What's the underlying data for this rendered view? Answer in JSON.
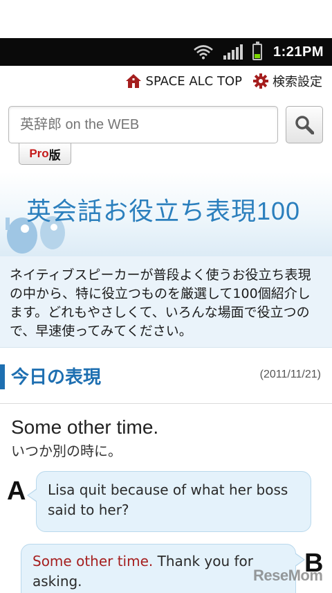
{
  "status_bar": {
    "time": "1:21PM",
    "icons": [
      "wifi-icon",
      "signal-icon",
      "battery-icon"
    ],
    "battery_color": "#7bd600"
  },
  "top_links": {
    "alc_top": "SPACE ALC TOP",
    "search_settings": "検索設定",
    "icons": [
      "home-icon",
      "gear-icon"
    ],
    "accent_color": "#a51e1e"
  },
  "search": {
    "placeholder": "英辞郎 on the WEB",
    "value": "",
    "button_icon": "search-icon",
    "pro_tab_prefix": "Pro",
    "pro_tab_suffix": "版"
  },
  "banner": {
    "title_main": "英会話お役立ち表現",
    "title_number": "100",
    "color": "#2b7fbd"
  },
  "intro": {
    "text": "ネイティブスピーカーが普段よく使うお役立ち表現の中から、特に役立つものを厳選して100個紹介します。どれもやさしくて、いろんな場面で役立つので、早速使ってみてください。"
  },
  "today": {
    "title": "今日の表現",
    "date": "(2011/11/21)"
  },
  "phrase": {
    "english": "Some other time.",
    "japanese": "いつか別の時に。"
  },
  "dialog": {
    "a_label": "A",
    "a_text": "Lisa quit because of what her boss said to her?",
    "b_label": "B",
    "b_highlight": "Some other time.",
    "b_rest": " Thank you for asking."
  },
  "watermark": "ReseMom"
}
